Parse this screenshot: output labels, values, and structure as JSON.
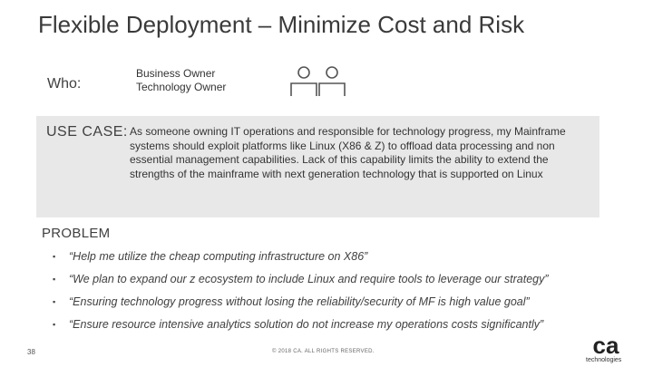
{
  "title": "Flexible Deployment – Minimize Cost and Risk",
  "who": {
    "label": "Who:",
    "lines": [
      "Business Owner",
      "Technology Owner"
    ],
    "icon": "two-people-icon"
  },
  "use_case": {
    "label": "USE CASE:",
    "text": "As someone owning IT operations and responsible for technology progress, my Mainframe systems should exploit platforms like Linux (X86 & Z) to offload data processing and non essential management capabilities. Lack of this capability limits the ability to extend the strengths of the mainframe with  next generation technology that is supported on Linux"
  },
  "problem": {
    "label": "PROBLEM",
    "bullet": "▪",
    "items": [
      "“Help me utilize the cheap computing infrastructure on X86”",
      "“We plan to expand our z ecosystem to include Linux and require tools to leverage our strategy”",
      "“Ensuring technology progress without losing the reliability/security of MF is high value goal”",
      "“Ensure resource intensive analytics solution do not increase my operations costs significantly”"
    ]
  },
  "footer": {
    "page_number": "38",
    "copyright": "© 2018 CA. ALL RIGHTS RESERVED.",
    "logo_text": "technologies",
    "logo_mark": "ca"
  },
  "colors": {
    "title": "#3a3a3a",
    "box_background": "#e8e8e8",
    "icon_stroke": "#555555"
  }
}
